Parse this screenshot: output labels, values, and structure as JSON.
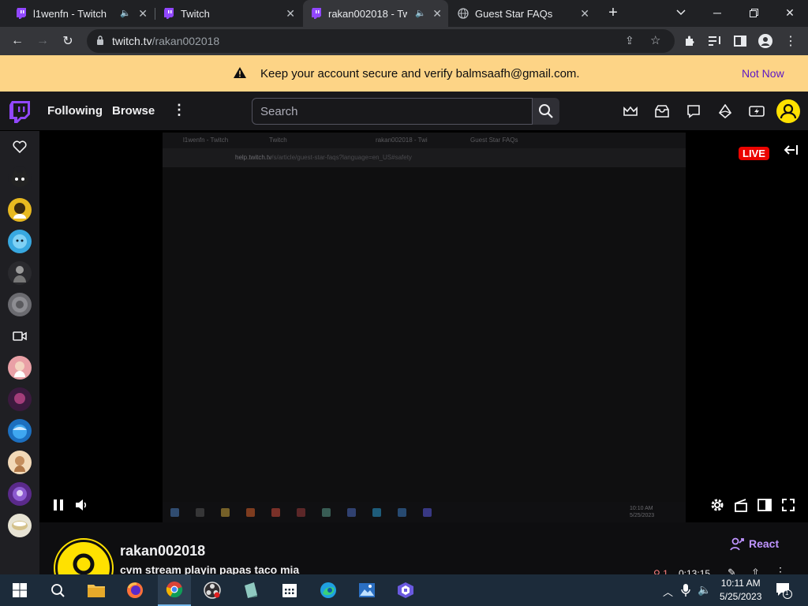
{
  "browser": {
    "tabs": [
      {
        "title": "l1wenfn - Twitch",
        "active": false,
        "muted_icon": "speaker-icon"
      },
      {
        "title": "Twitch",
        "active": false
      },
      {
        "title": "rakan002018 - Twi",
        "active": true,
        "muted_icon": "speaker-icon"
      },
      {
        "title": "Guest Star FAQs",
        "active": false
      }
    ],
    "url_host": "twitch.tv",
    "url_path": "/rakan002018"
  },
  "banner": {
    "message": "Keep your account secure and verify balmsaafh@gmail.com.",
    "action": "Not Now"
  },
  "topnav": {
    "following": "Following",
    "browse": "Browse",
    "search_placeholder": "Search"
  },
  "player": {
    "live_badge": "LIVE",
    "inner_screen": {
      "tabs": [
        "l1wenfn - Twitch",
        "Twitch",
        "rakan002018 - Twi",
        "Guest Star FAQs"
      ],
      "url_host": "help.twitch.tv",
      "url_path": "/s/article/guest-star-faqs?language=en_US#safety",
      "clock_time": "10:10 AM",
      "clock_date": "5/25/2023"
    }
  },
  "channel": {
    "name": "rakan002018",
    "stream_title": "cvm stream playin papas taco mia",
    "react_label": "React",
    "viewers": "1",
    "uptime": "0:13:15"
  },
  "taskbar": {
    "time": "10:11 AM",
    "date": "5/25/2023",
    "notifications": "1"
  },
  "colors": {
    "twitch_purple": "#9147ff",
    "banner_bg": "#fdd486",
    "live_red": "#eb0400"
  }
}
